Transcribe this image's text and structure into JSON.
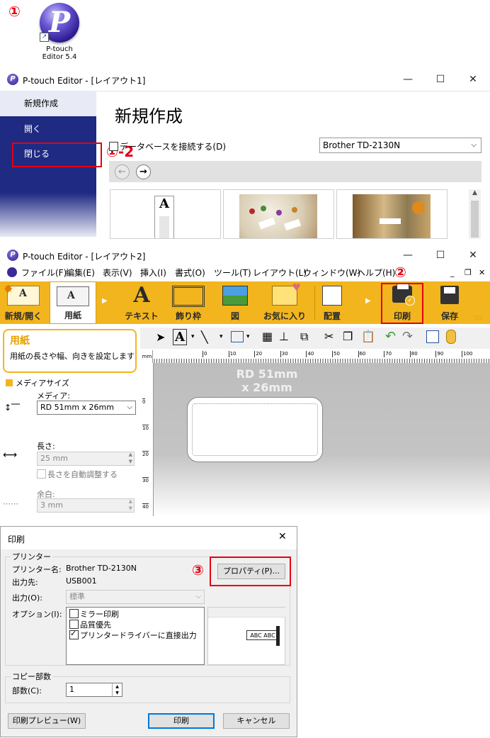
{
  "step_labels": {
    "s1": "①",
    "s1_2": "①-2",
    "s2": "②",
    "s3": "③"
  },
  "desktop_icon": {
    "glyph": "P",
    "line1": "P-touch",
    "line2": "Editor 5.4"
  },
  "win1": {
    "title": "P-touch Editor - [レイアウト1]",
    "sidebar": [
      "新規作成",
      "開く",
      "閉じる"
    ],
    "heading": "新規作成",
    "db_connect": "データベースを接続する(D)",
    "printer": "Brother TD-2130N",
    "back": "←",
    "forward": "→"
  },
  "win2": {
    "title": "P-touch Editor - [レイアウト2]",
    "menus": [
      "ファイル(F)",
      "編集(E)",
      "表示(V)",
      "挿入(I)",
      "書式(O)",
      "ツール(T)",
      "レイアウト(L)",
      "ウィンドウ(W)",
      "ヘルプ(H)"
    ],
    "ribbon": [
      "新規/開く",
      "用紙",
      "テキスト",
      "飾り枠",
      "図",
      "お気に入り",
      "配置",
      "印刷",
      "保存"
    ],
    "ribbon_more": "ss",
    "panel_title": "用紙",
    "panel_desc": "用紙の長さや幅、向きを設定します",
    "media_size": "メディアサイズ",
    "media_label": "メディア:",
    "media_value": "RD 51mm x 26mm",
    "length_label": "長さ:",
    "length_value": "25 mm",
    "auto_adjust": "長さを自動調整する",
    "margin_label": "余白:",
    "margin_value": "3 mm",
    "canvas_label1": "RD 51mm",
    "canvas_label2": "x 26mm",
    "ruler_unit": "mm",
    "ruler_marks": [
      "0",
      "10",
      "20",
      "30",
      "40",
      "50",
      "60",
      "70",
      "80",
      "90",
      "100"
    ],
    "vruler_marks": [
      "0",
      "10",
      "20",
      "30",
      "40"
    ]
  },
  "dialog": {
    "title": "印刷",
    "close": "✕",
    "group_printer": "プリンター",
    "printer_name_label": "プリンター名:",
    "printer_name": "Brother TD-2130N",
    "output_dest_label": "出力先:",
    "output_dest": "USB001",
    "output_label": "出力(O):",
    "output_value": "標準",
    "options_label": "オプション(I):",
    "options": [
      {
        "label": "ミラー印刷",
        "checked": false
      },
      {
        "label": "品質優先",
        "checked": false
      },
      {
        "label": "プリンタードライバーに直接出力",
        "checked": true
      }
    ],
    "properties_btn": "プロパティ(P)...",
    "preview_text": "ABC ABC",
    "group_copies": "コピー部数",
    "copies_label": "部数(C):",
    "copies_value": "1",
    "preview_btn": "印刷プレビュー(W)",
    "print_btn": "印刷",
    "cancel_btn": "キャンセル"
  },
  "colors": {
    "accent_red": "#e60012",
    "ribbon": "#f2b51d",
    "sidebar": "#1f2a83"
  }
}
